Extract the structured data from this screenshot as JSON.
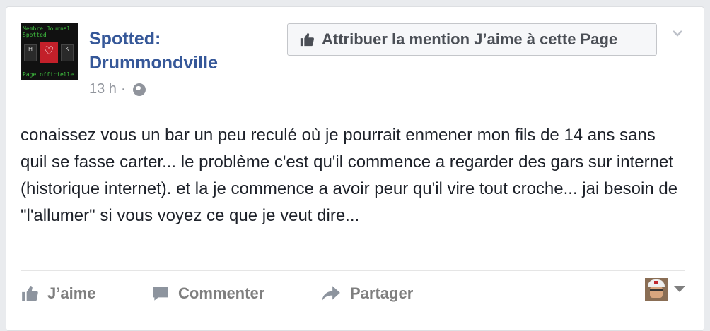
{
  "post": {
    "avatar": {
      "line1": "Membre Journal",
      "line2": "Spotted",
      "line3": "Page officielle",
      "key_left": "H",
      "key_right": "K"
    },
    "page_name_line1": "Spotted:",
    "page_name_line2": "Drummondville",
    "timestamp": "13 h",
    "separator": "·",
    "privacy_icon": "globe-icon",
    "like_page_label": "Attribuer la mention J’aime à cette Page",
    "text": "conaissez vous un bar un peu reculé où je pourrait enmener mon fils de 14 ans sans quil se fasse carter... le problème c'est qu'il commence a regarder des gars sur internet (historique internet). et la je commence a avoir peur qu'il vire tout croche... jai besoin de \"l'allumer\" si vous voyez ce que je veut dire..."
  },
  "actions": {
    "like_label": "J’aime",
    "comment_label": "Commenter",
    "share_label": "Partager"
  },
  "colors": {
    "link_blue": "#365899",
    "muted_gray": "#90949c",
    "action_gray": "#7f7f7f",
    "background": "#e9ebee"
  }
}
